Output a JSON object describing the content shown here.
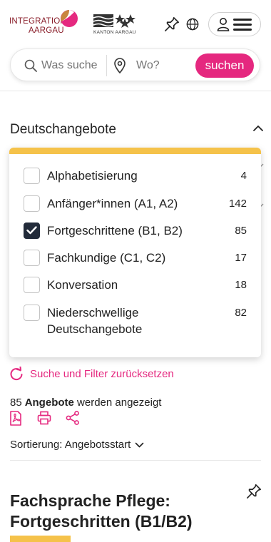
{
  "header": {
    "logo_integration": {
      "line1": "INTEGRATION",
      "line2": "AARGAU"
    },
    "logo_kanton": {
      "caption": "KANTON AARGAU"
    },
    "icons": [
      "pin-icon",
      "globe-icon",
      "user-icon",
      "hamburger-icon"
    ]
  },
  "search": {
    "what_placeholder": "Was suche",
    "where_placeholder": "Wo?",
    "submit_label": "suchen"
  },
  "filter": {
    "title": "Deutschangebote",
    "options": [
      {
        "label": "Alphabetisierung",
        "count": "4",
        "checked": false
      },
      {
        "label": "Anfänger*innen (A1, A2)",
        "count": "142",
        "checked": false
      },
      {
        "label": "Fortgeschrittene (B1, B2)",
        "count": "85",
        "checked": true
      },
      {
        "label": "Fachkundige (C1, C2)",
        "count": "17",
        "checked": false
      },
      {
        "label": "Konversation",
        "count": "18",
        "checked": false
      },
      {
        "label": "Niederschwellige",
        "label2": "Deutschangebote",
        "count": "82",
        "checked": false
      }
    ]
  },
  "reset_label": "Suche und Filter zurücksetzen",
  "results": {
    "count": "85",
    "noun": "Angebote",
    "suffix": "werden angezeigt"
  },
  "actions": [
    "pdf-icon",
    "print-icon",
    "share-icon"
  ],
  "sort_label": "Sortierung: Angebotsstart",
  "card": {
    "title_line1": "Fachsprache Pflege:",
    "title_line2": "Fortgeschritten (B1/B2)"
  },
  "colors": {
    "accent_pink": "#e5287f",
    "accent_yellow": "#f5c24a",
    "dark": "#222b3a",
    "brand_red": "#8a1e2a"
  }
}
